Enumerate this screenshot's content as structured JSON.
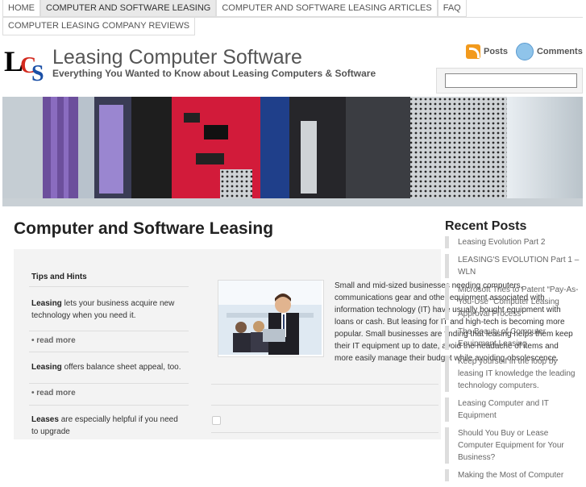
{
  "nav": {
    "items": [
      {
        "label": "HOME",
        "active": false
      },
      {
        "label": "COMPUTER AND SOFTWARE LEASING",
        "active": true
      },
      {
        "label": "COMPUTER AND SOFTWARE LEASING ARTICLES",
        "active": false
      },
      {
        "label": "FAQ",
        "active": false
      }
    ],
    "items_row2": [
      {
        "label": "COMPUTER LEASING COMPANY REVIEWS",
        "active": false
      }
    ]
  },
  "header": {
    "logo_letters": [
      "L",
      "C",
      "S"
    ],
    "site_title": "Leasing Computer Software",
    "tagline": "Everything You Wanted to Know about Leasing Computers & Software",
    "posts_feed": "Posts",
    "comments_feed": "Comments",
    "search_value": ""
  },
  "page": {
    "title": "Computer and Software Leasing"
  },
  "tips": {
    "title": "Tips and Hints",
    "items": [
      {
        "bold": "Leasing",
        "text": " lets your business acquire new technology when you need it.",
        "read_more": "• read more"
      },
      {
        "bold": "Leasing",
        "text": " offers balance sheet appeal, too.",
        "read_more": "• read more"
      },
      {
        "bold": "Leases",
        "text": " are especially helpful if you need to upgrade",
        "read_more": ""
      }
    ]
  },
  "main_text": "Small and mid-sized businesses needing computers, communications gear and other equipment associated with information technology (IT) have usually bought equipment with loans or cash. But leasing for IT and high-tech is becoming more popular. Small businesses are finding that leasing helps them keep their IT equipment up to date, avoid the headache of items and more easily manage their budget while avoiding obsolescence.",
  "sidebar": {
    "title": "Recent Posts",
    "posts": [
      "Leasing Evolution Part 2",
      "LEASING'S EVOLUTION Part 1 – WLN",
      "Microsoft Tries to Patent “Pay-As-You-Use” Computer Leasing Approval Process",
      "The Beauty of Computer Equipment Leasing",
      "Keep yourself in the loop by leasing IT knowledge the leading technology computers.",
      "Leasing Computer and IT Equipment",
      "Should You Buy or Lease Computer Equipment for Your Business?",
      "Making the Most of Computer"
    ]
  },
  "colors": {
    "logo_red": "#d32a1f",
    "logo_blue": "#1a4fa6",
    "rss_orange": "#f29a1d",
    "nav_active": "#e9e9e9"
  }
}
